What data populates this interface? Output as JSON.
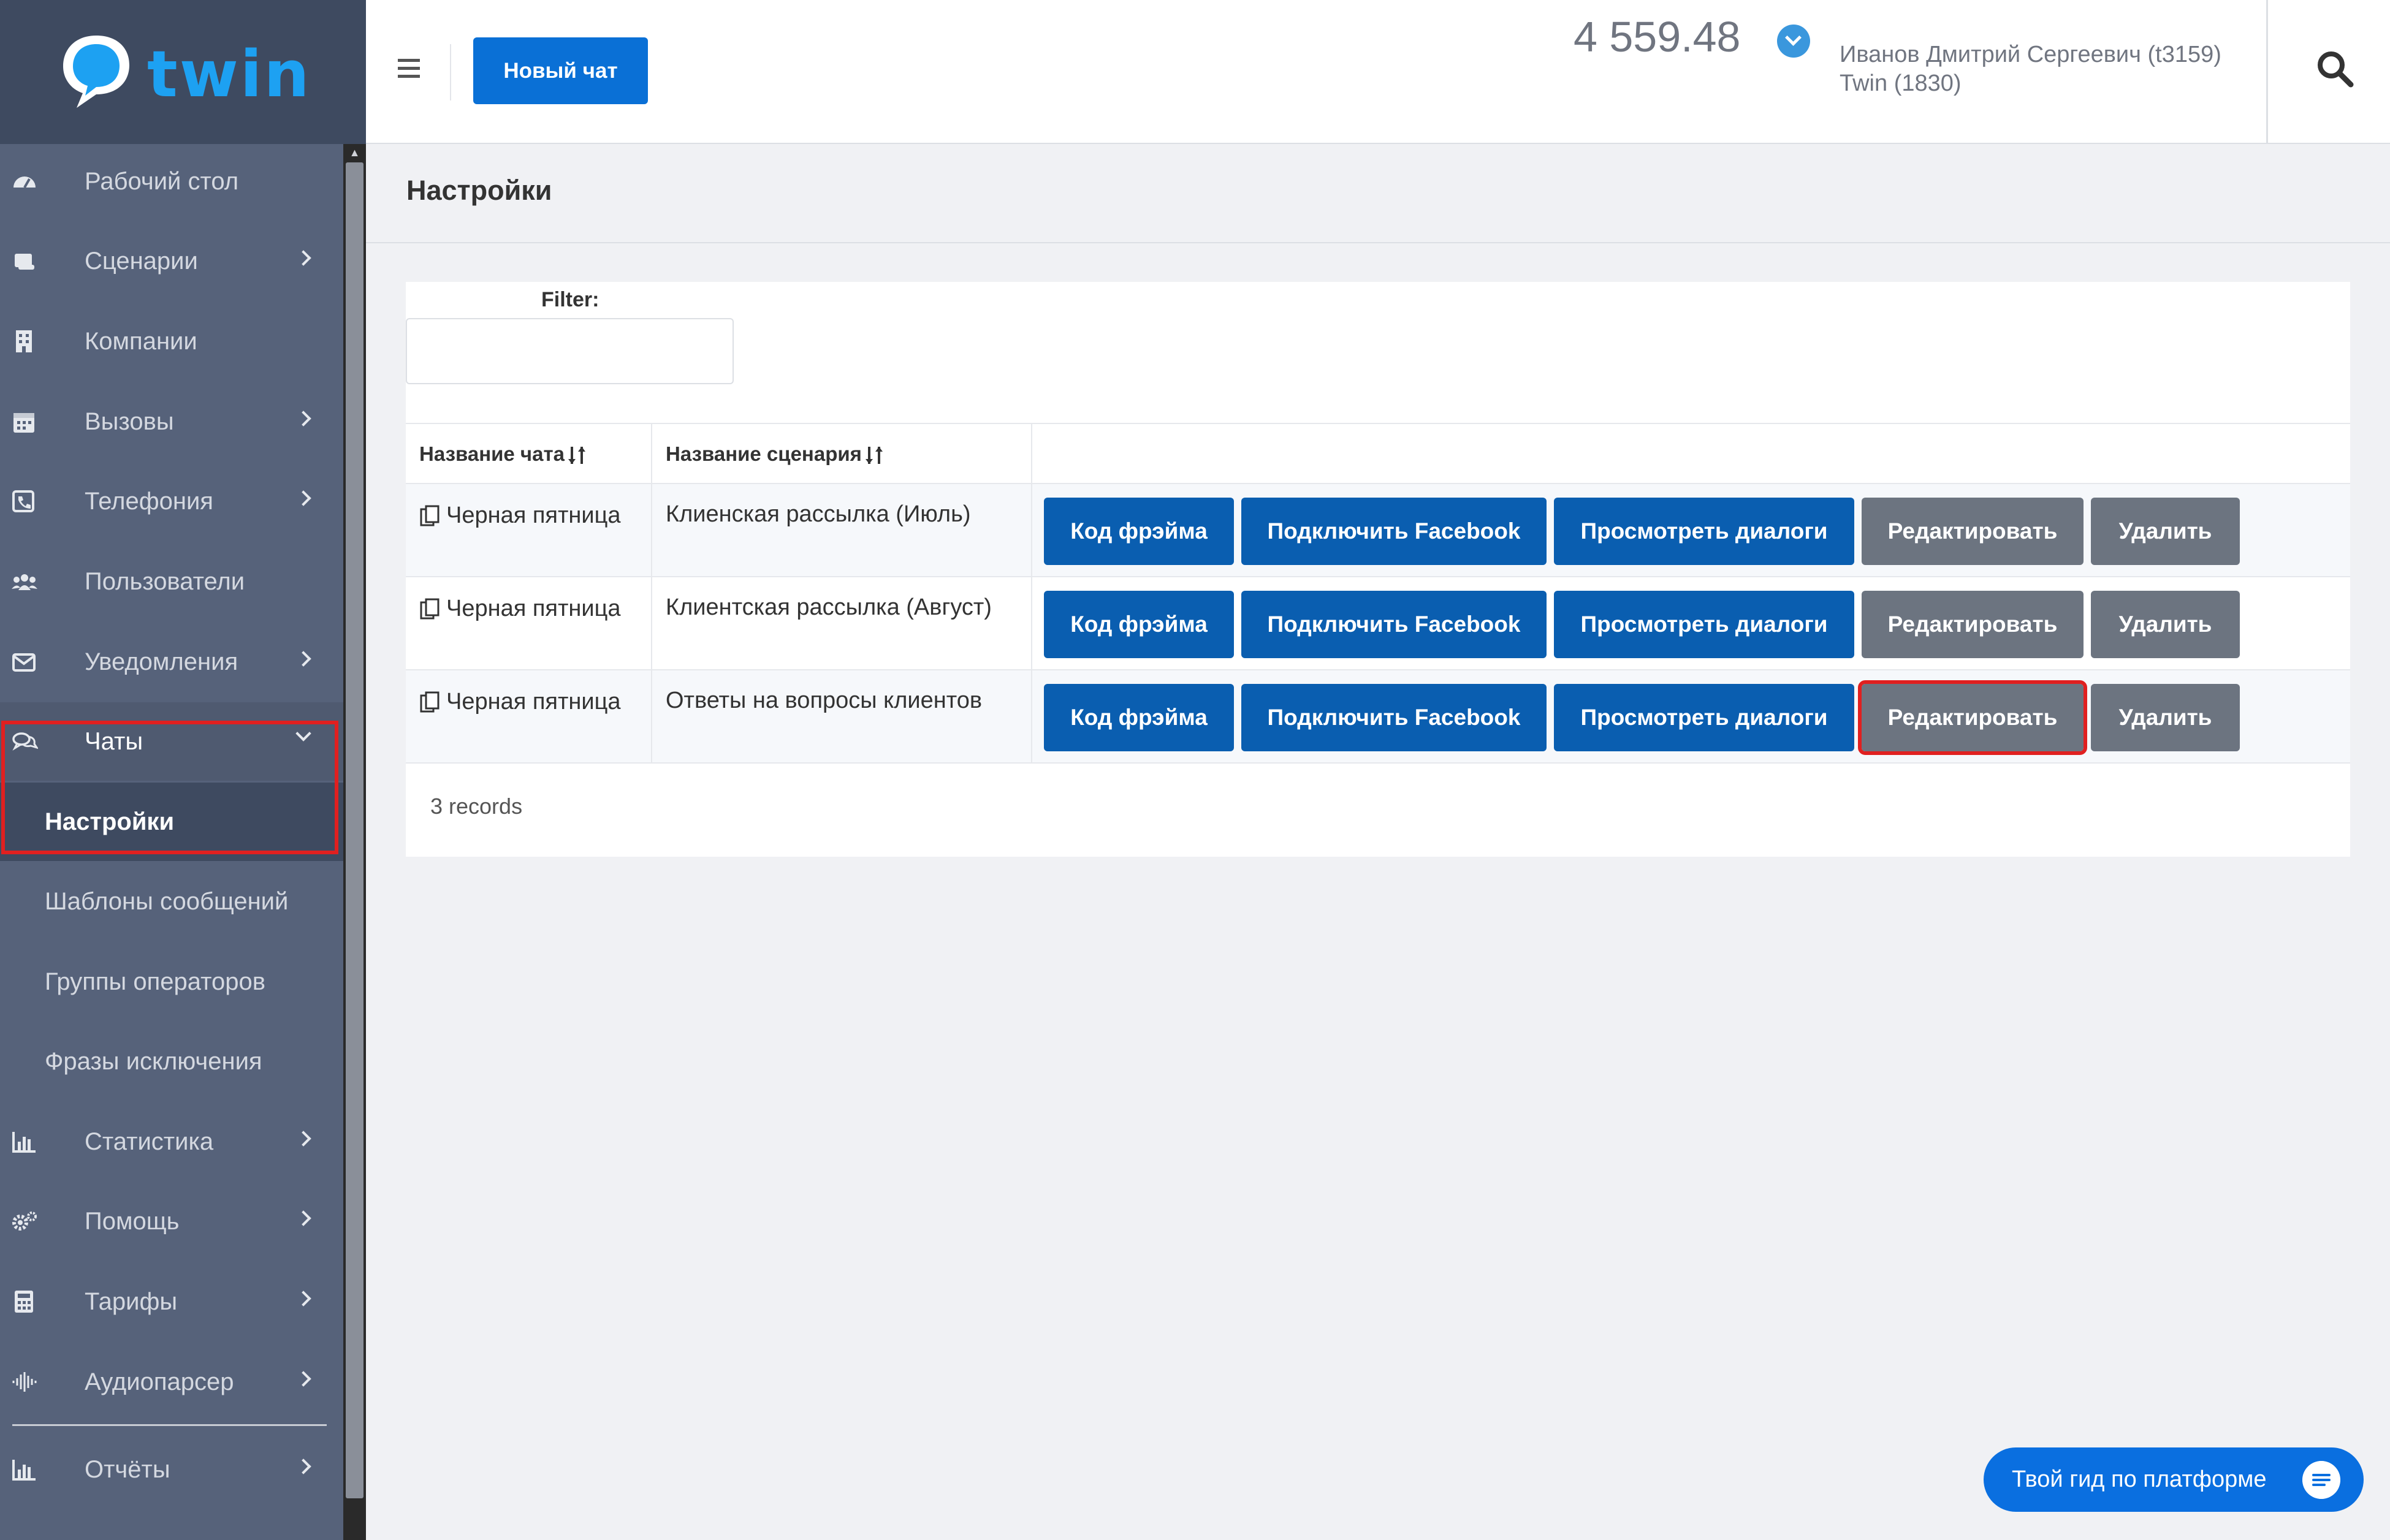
{
  "app": {
    "brand": "twin",
    "colors": {
      "accent": "#0a70d6",
      "sidebar": "#56627a",
      "highlight": "#e02020"
    }
  },
  "header": {
    "new_chat_label": "Новый чат",
    "balance": "4 559.48",
    "user_name": "Иванов Дмитрий Сергеевич (t3159)",
    "user_org": "Twin (1830)"
  },
  "sidebar": {
    "items": [
      {
        "label": "Рабочий стол",
        "icon": "dashboard-icon"
      },
      {
        "label": "Сценарии",
        "icon": "scroll-icon"
      },
      {
        "label": "Компании",
        "icon": "building-icon"
      },
      {
        "label": "Вызовы",
        "icon": "calendar-icon"
      },
      {
        "label": "Телефония",
        "icon": "phone-icon"
      },
      {
        "label": "Пользователи",
        "icon": "users-icon"
      },
      {
        "label": "Уведомления",
        "icon": "envelope-icon"
      },
      {
        "label": "Чаты",
        "icon": "chat-icon"
      },
      {
        "label": "Статистика",
        "icon": "bar-chart-icon"
      },
      {
        "label": "Помощь",
        "icon": "gears-icon"
      },
      {
        "label": "Тарифы",
        "icon": "calculator-icon"
      },
      {
        "label": "Аудиопарсер",
        "icon": "audio-icon"
      },
      {
        "label": "Отчёты",
        "icon": "report-chart-icon"
      }
    ],
    "chats_sub": [
      "Настройки",
      "Шаблоны сообщений",
      "Группы операторов",
      "Фразы исключения"
    ]
  },
  "main": {
    "title": "Настройки",
    "filter_label": "Filter:",
    "filter_value": "",
    "columns": [
      "Название чата",
      "Название сценария"
    ],
    "rows": [
      {
        "chat": "Черная пятница",
        "scenario": "Клиенская рассылка (Июль)"
      },
      {
        "chat": "Черная пятница",
        "scenario": "Клиентская рассылка (Август)"
      },
      {
        "chat": "Черная пятница",
        "scenario": "Ответы на вопросы клиентов"
      }
    ],
    "actions": {
      "frame_code": "Код фрэйма",
      "connect_facebook": "Подключить Facebook",
      "view_dialogs": "Просмотреть диалоги",
      "edit": "Редактировать",
      "delete": "Удалить"
    },
    "records_text": "3 records"
  },
  "guide": {
    "label": "Твой гид по платформе"
  }
}
